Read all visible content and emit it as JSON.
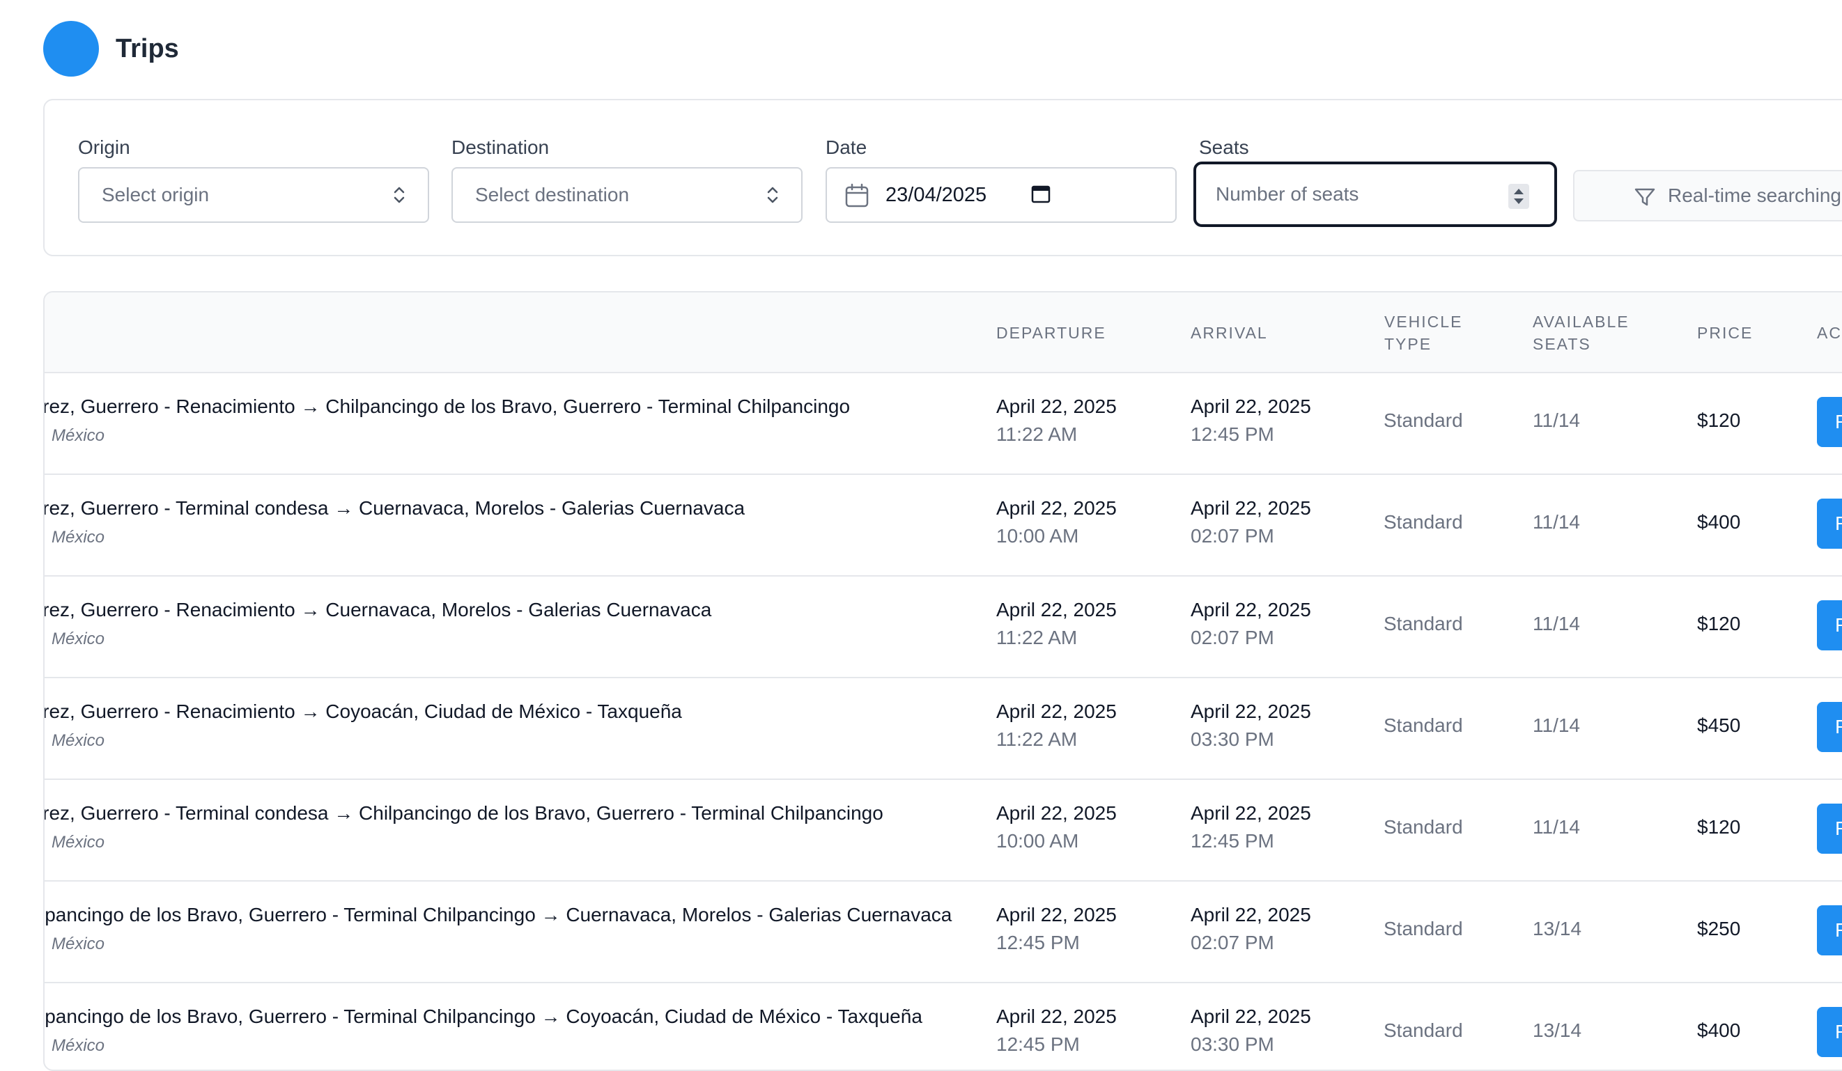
{
  "header": {
    "title": "Trips"
  },
  "filters": {
    "origin": {
      "label": "Origin",
      "placeholder": "Select origin"
    },
    "destination": {
      "label": "Destination",
      "placeholder": "Select destination"
    },
    "date": {
      "label": "Date",
      "value": "23/04/2025"
    },
    "seats": {
      "label": "Seats",
      "placeholder": "Number of seats"
    },
    "realtime_button": "Real-time searching"
  },
  "table": {
    "columns": {
      "departure": "DEPARTURE",
      "arrival": "ARRIVAL",
      "vehicle_type_1": "VEHICLE",
      "vehicle_type_2": "TYPE",
      "available_seats_1": "AVAILABLE",
      "available_seats_2": "SEATS",
      "price": "PRICE",
      "actions": "AC"
    },
    "rows": [
      {
        "route": "Juárez, Guerrero - Renacimiento → Chilpancingo de los Bravo, Guerrero - Terminal Chilpancingo",
        "country": "México",
        "dep_date": "April 22, 2025",
        "dep_time": "11:22 AM",
        "arr_date": "April 22, 2025",
        "arr_time": "12:45 PM",
        "vehicle": "Standard",
        "seats": "11/14",
        "price": "$120",
        "action": "R"
      },
      {
        "route": "Juárez, Guerrero - Terminal condesa → Cuernavaca, Morelos - Galerias Cuernavaca",
        "country": "México",
        "dep_date": "April 22, 2025",
        "dep_time": "10:00 AM",
        "arr_date": "April 22, 2025",
        "arr_time": "02:07 PM",
        "vehicle": "Standard",
        "seats": "11/14",
        "price": "$400",
        "action": "R"
      },
      {
        "route": "Juárez, Guerrero - Renacimiento → Cuernavaca, Morelos - Galerias Cuernavaca",
        "country": "México",
        "dep_date": "April 22, 2025",
        "dep_time": "11:22 AM",
        "arr_date": "April 22, 2025",
        "arr_time": "02:07 PM",
        "vehicle": "Standard",
        "seats": "11/14",
        "price": "$120",
        "action": "R"
      },
      {
        "route": "Juárez, Guerrero - Renacimiento → Coyoacán, Ciudad de México - Taxqueña",
        "country": "México",
        "dep_date": "April 22, 2025",
        "dep_time": "11:22 AM",
        "arr_date": "April 22, 2025",
        "arr_time": "03:30 PM",
        "vehicle": "Standard",
        "seats": "11/14",
        "price": "$450",
        "action": "R"
      },
      {
        "route": "Juárez, Guerrero - Terminal condesa → Chilpancingo de los Bravo, Guerrero - Terminal Chilpancingo",
        "country": "México",
        "dep_date": "April 22, 2025",
        "dep_time": "10:00 AM",
        "arr_date": "April 22, 2025",
        "arr_time": "12:45 PM",
        "vehicle": "Standard",
        "seats": "11/14",
        "price": "$120",
        "action": "R"
      },
      {
        "route": "Chilpancingo de los Bravo, Guerrero - Terminal Chilpancingo → Cuernavaca, Morelos - Galerias Cuernavaca",
        "country": "México",
        "dep_date": "April 22, 2025",
        "dep_time": "12:45 PM",
        "arr_date": "April 22, 2025",
        "arr_time": "02:07 PM",
        "vehicle": "Standard",
        "seats": "13/14",
        "price": "$250",
        "action": "R"
      },
      {
        "route": "Chilpancingo de los Bravo, Guerrero - Terminal Chilpancingo → Coyoacán, Ciudad de México - Taxqueña",
        "country": "México",
        "dep_date": "April 22, 2025",
        "dep_time": "12:45 PM",
        "arr_date": "April 22, 2025",
        "arr_time": "03:30 PM",
        "vehicle": "Standard",
        "seats": "13/14",
        "price": "$400",
        "action": "R"
      }
    ]
  },
  "colors": {
    "accent": "#1f8ef1",
    "border": "#e5e7eb",
    "muted": "#6b7280"
  }
}
